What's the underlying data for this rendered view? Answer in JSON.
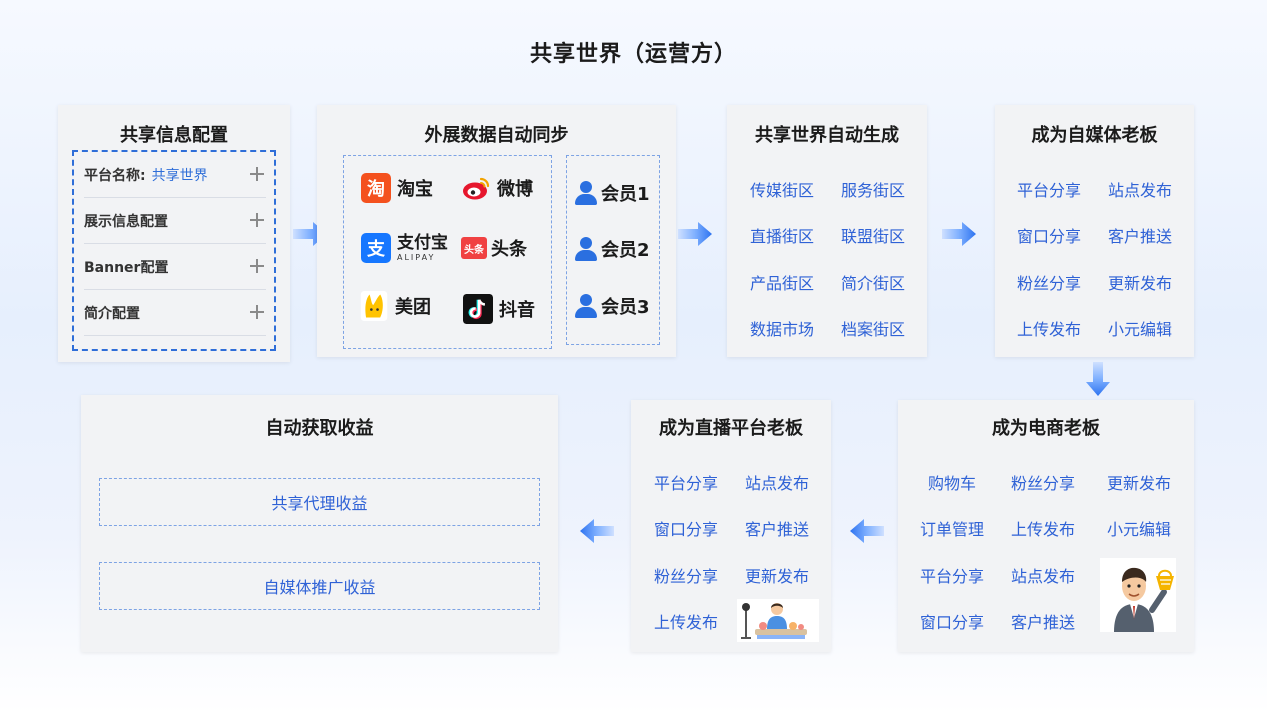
{
  "title": "共享世界（运营方）",
  "config": {
    "title": "共享信息配置",
    "rows": [
      {
        "label": "平台名称:",
        "value": "共享世界"
      },
      {
        "label": "展示信息配置",
        "value": ""
      },
      {
        "label": "Banner配置",
        "value": ""
      },
      {
        "label": "简介配置",
        "value": ""
      }
    ]
  },
  "sync": {
    "title": "外展数据自动同步",
    "apps": [
      {
        "name": "淘宝",
        "icon": "taobao-icon",
        "color": "#f4511e"
      },
      {
        "name": "微博",
        "icon": "weibo-icon",
        "color": "#e6162d"
      },
      {
        "name": "支付宝",
        "icon": "alipay-icon",
        "color": "#1677ff"
      },
      {
        "name": "头条",
        "icon": "toutiao-icon",
        "color": "#f04142"
      },
      {
        "name": "美团",
        "icon": "meituan-icon",
        "color": "#ffc300"
      },
      {
        "name": "抖音",
        "icon": "douyin-icon",
        "color": "#111111"
      }
    ],
    "alipay_sub": "ALIPAY",
    "logo_glyphs": {
      "taobao": "淘",
      "alipay": "支",
      "toutiao": "头条"
    },
    "members": [
      "会员1",
      "会员2",
      "会员3"
    ]
  },
  "auto_gen": {
    "title": "共享世界自动生成",
    "items": [
      "传媒街区",
      "服务街区",
      "直播街区",
      "联盟街区",
      "产品街区",
      "简介街区",
      "数据市场",
      "档案街区"
    ]
  },
  "media": {
    "title": "成为自媒体老板",
    "items": [
      "平台分享",
      "站点发布",
      "窗口分享",
      "客户推送",
      "粉丝分享",
      "更新发布",
      "上传发布",
      "小元编辑"
    ]
  },
  "ecommerce": {
    "title": "成为电商老板",
    "items": [
      "购物车",
      "粉丝分享",
      "更新发布",
      "订单管理",
      "上传发布",
      "小元编辑",
      "平台分享",
      "站点发布",
      "窗口分享",
      "客户推送"
    ]
  },
  "live": {
    "title": "成为直播平台老板",
    "items": [
      "平台分享",
      "站点发布",
      "窗口分享",
      "客户推送",
      "粉丝分享",
      "更新发布",
      "上传发布"
    ]
  },
  "income": {
    "title": "自动获取收益",
    "items": [
      "共享代理收益",
      "自媒体推广收益"
    ]
  },
  "colors": {
    "accent": "#2f62d6",
    "arrow": "#3a7cf0",
    "card": "#f2f3f5"
  }
}
